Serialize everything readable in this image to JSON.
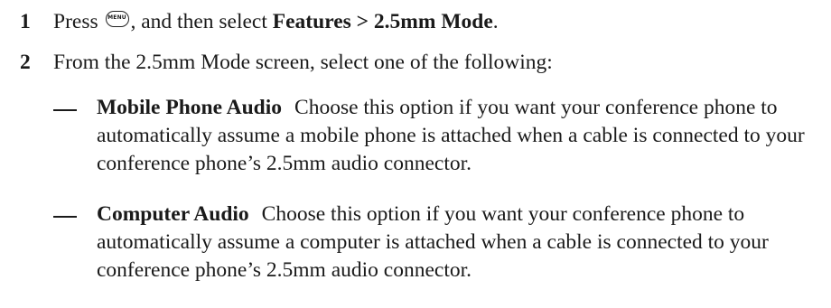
{
  "steps": [
    {
      "number": "1",
      "text_before": "Press ",
      "icon": "menu-key-icon",
      "icon_label": "MENU",
      "text_after": ", and then select ",
      "path": "Features > 2.5mm Mode",
      "end": "."
    },
    {
      "number": "2",
      "text": "From the 2.5mm Mode screen, select one of the following:"
    }
  ],
  "options": [
    {
      "bullet": "—",
      "title": "Mobile Phone Audio",
      "description": "Choose this option if you want your conference phone to automatically assume a mobile phone is attached when a cable is connected to your conference phone’s 2.5mm audio connector."
    },
    {
      "bullet": "—",
      "title": "Computer Audio",
      "description": "Choose this option if you want your conference phone to automatically assume a computer is attached when a cable is connected to your conference phone’s 2.5mm audio connector."
    }
  ]
}
